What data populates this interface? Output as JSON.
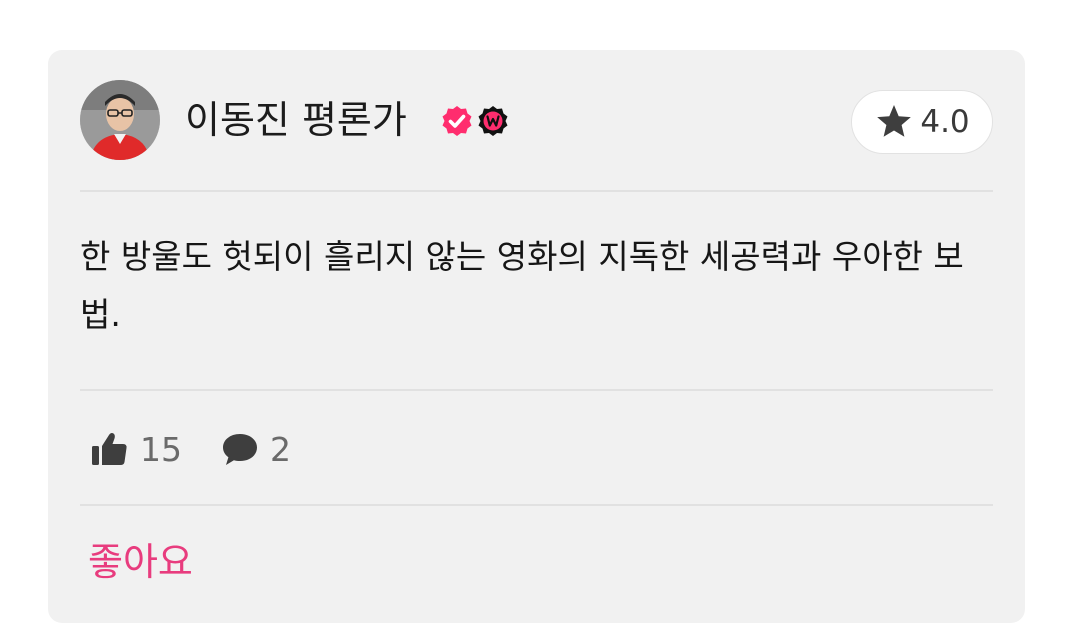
{
  "review": {
    "author": {
      "name": "이동진 평론가",
      "avatar_icon": "person-avatar",
      "badges": [
        "verified-badge-icon",
        "watcha-w-badge-icon"
      ]
    },
    "rating": {
      "icon": "star-icon",
      "value": "4.0"
    },
    "text": "한 방울도 헛되이 흘리지 않는 영화의 지독한 세공력과 우아한 보법.",
    "stats": {
      "likes_icon": "thumbs-up-icon",
      "likes": "15",
      "comments_icon": "comment-icon",
      "comments": "2"
    },
    "action": {
      "like_label": "좋아요"
    }
  },
  "colors": {
    "card_background": "#f1f1f1",
    "accent_pink": "#e83c7e",
    "badge_pink": "#ff2d6e",
    "divider": "#e1e1e1",
    "muted_text": "#6a6a6a"
  }
}
